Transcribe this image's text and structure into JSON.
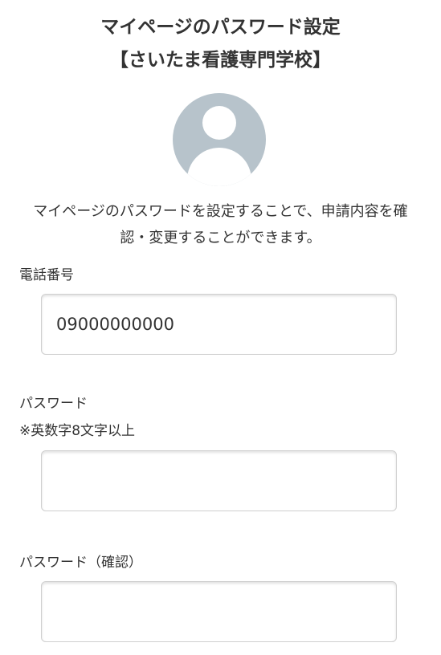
{
  "header": {
    "title": "マイページのパスワード設定",
    "school": "【さいたま看護専門学校】"
  },
  "avatar": {
    "icon": "user-avatar-icon",
    "color": "#b7c3cb"
  },
  "description": {
    "line1": "マイページのパスワードを設定することで、申請内容を確",
    "line2": "認・変更することができます。"
  },
  "form": {
    "phone": {
      "label": "電話番号",
      "value": "09000000000"
    },
    "password": {
      "label": "パスワード",
      "hint": "※英数字8文字以上",
      "value": ""
    },
    "password_confirm": {
      "label": "パスワード（確認）",
      "value": ""
    }
  }
}
